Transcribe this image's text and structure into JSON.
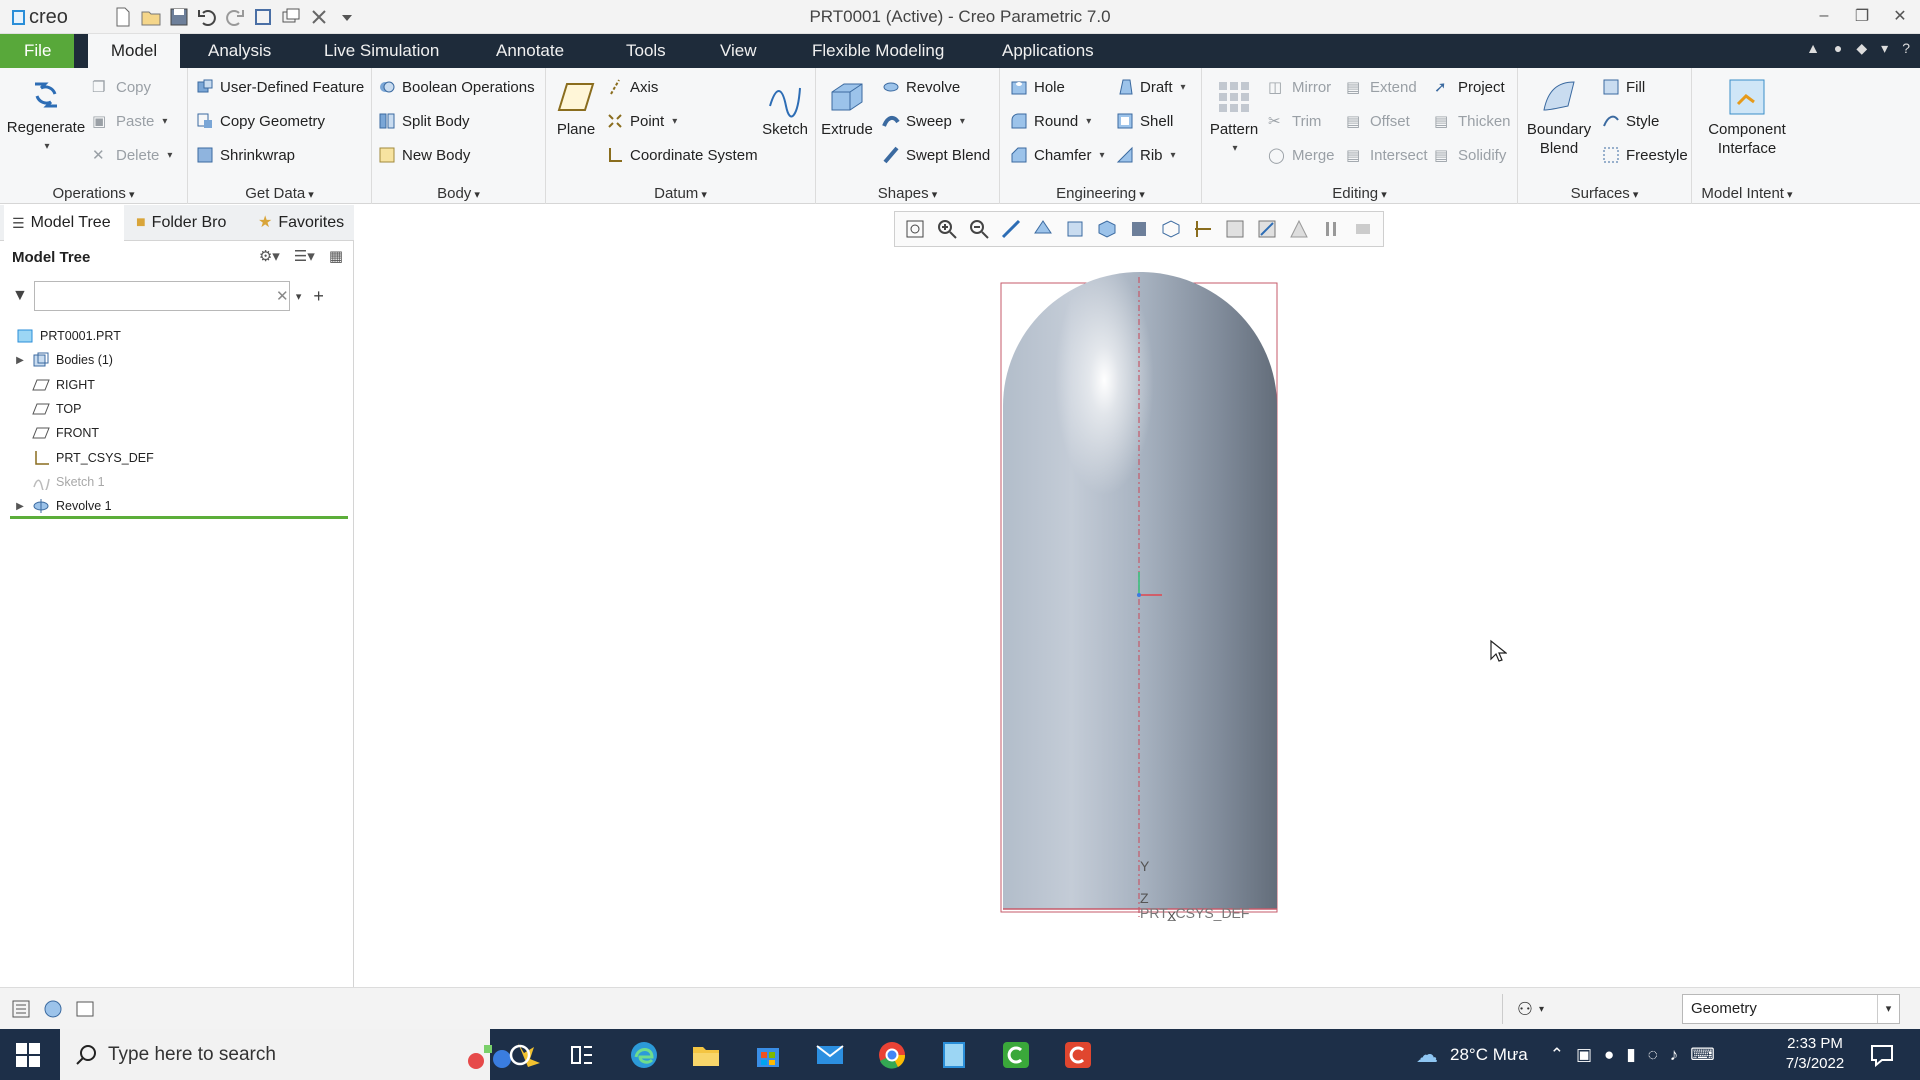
{
  "titlebar": {
    "logo_text": "creo",
    "window_title": "PRT0001 (Active) - Creo Parametric 7.0"
  },
  "menu": {
    "tabs": [
      "File",
      "Model",
      "Analysis",
      "Live Simulation",
      "Annotate",
      "Tools",
      "View",
      "Flexible Modeling",
      "Applications"
    ],
    "active": "Model"
  },
  "ribbon": {
    "operations": {
      "label": "Operations",
      "regenerate": "Regenerate",
      "copy": "Copy",
      "paste": "Paste",
      "delete": "Delete"
    },
    "get_data": {
      "label": "Get Data",
      "udf": "User-Defined Feature",
      "copy_geometry": "Copy Geometry",
      "shrinkwrap": "Shrinkwrap"
    },
    "body": {
      "label": "Body",
      "boolean": "Boolean Operations",
      "split": "Split Body",
      "new": "New Body"
    },
    "datum": {
      "label": "Datum",
      "plane": "Plane",
      "axis": "Axis",
      "point": "Point",
      "csys": "Coordinate System",
      "sketch": "Sketch"
    },
    "shapes": {
      "label": "Shapes",
      "extrude": "Extrude",
      "revolve": "Revolve",
      "sweep": "Sweep",
      "swept_blend": "Swept Blend"
    },
    "engineering": {
      "label": "Engineering",
      "hole": "Hole",
      "round": "Round",
      "chamfer": "Chamfer",
      "draft": "Draft",
      "shell": "Shell",
      "rib": "Rib"
    },
    "editing": {
      "label": "Editing",
      "pattern": "Pattern",
      "mirror": "Mirror",
      "trim": "Trim",
      "merge": "Merge",
      "extend": "Extend",
      "offset": "Offset",
      "intersect": "Intersect",
      "project": "Project",
      "thicken": "Thicken",
      "solidify": "Solidify"
    },
    "surfaces": {
      "label": "Surfaces",
      "boundary_blend_1": "Boundary",
      "boundary_blend_2": "Blend",
      "fill": "Fill",
      "style": "Style",
      "freestyle": "Freestyle"
    },
    "model_intent": {
      "label": "Model Intent",
      "component_1": "Component",
      "component_2": "Interface"
    }
  },
  "left_panel": {
    "tabs": [
      "Model Tree",
      "Folder Bro",
      "Favorites"
    ],
    "header": "Model Tree",
    "filter_value": "",
    "tree": [
      {
        "label": "PRT0001.PRT",
        "icon": "part-icon",
        "expandable": false,
        "indent": 0,
        "dim": false
      },
      {
        "label": "Bodies (1)",
        "icon": "bodies-icon",
        "expandable": true,
        "indent": 1,
        "dim": false
      },
      {
        "label": "RIGHT",
        "icon": "datum-plane-icon",
        "expandable": false,
        "indent": 1,
        "dim": false
      },
      {
        "label": "TOP",
        "icon": "datum-plane-icon",
        "expandable": false,
        "indent": 1,
        "dim": false
      },
      {
        "label": "FRONT",
        "icon": "datum-plane-icon",
        "expandable": false,
        "indent": 1,
        "dim": false
      },
      {
        "label": "PRT_CSYS_DEF",
        "icon": "csys-icon",
        "expandable": false,
        "indent": 1,
        "dim": false
      },
      {
        "label": "Sketch 1",
        "icon": "sketch-icon",
        "expandable": false,
        "indent": 1,
        "dim": true
      },
      {
        "label": "Revolve 1",
        "icon": "revolve-icon",
        "expandable": true,
        "indent": 1,
        "dim": false
      }
    ]
  },
  "graphics": {
    "csys_label": "PRT_CSYS_DEF",
    "axis_y": "Y",
    "axis_z": "Z",
    "axis_x": "X",
    "model_color": "#9aa6b5"
  },
  "statusbar": {
    "selection_filter": "Geometry"
  },
  "taskbar": {
    "search_placeholder": "Type here to search",
    "weather": "28°C Mưa",
    "time": "2:33 PM",
    "date": "7/3/2022"
  }
}
